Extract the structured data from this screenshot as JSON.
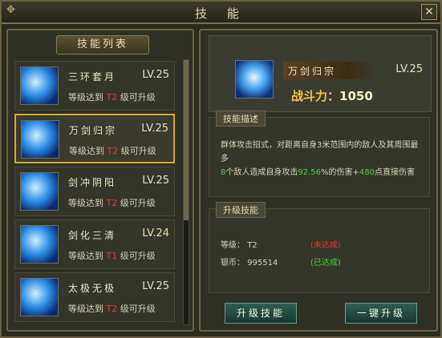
{
  "window": {
    "title": "技 能",
    "close_label": "✕"
  },
  "skill_list": {
    "header": "技能列表",
    "items": [
      {
        "name": "三环套月",
        "level": "LV.25",
        "req_prefix": "等级达到",
        "req_tier": "T2",
        "req_suffix": "级可升级"
      },
      {
        "name": "万剑归宗",
        "level": "LV.25",
        "req_prefix": "等级达到",
        "req_tier": "T2",
        "req_suffix": "级可升级"
      },
      {
        "name": "剑冲阴阳",
        "level": "LV.25",
        "req_prefix": "等级达到",
        "req_tier": "T2",
        "req_suffix": "级可升级"
      },
      {
        "name": "剑化三清",
        "level": "LV.24",
        "req_prefix": "等级达到",
        "req_tier": "T1",
        "req_suffix": "级可升级"
      },
      {
        "name": "太极无极",
        "level": "LV.25",
        "req_prefix": "等级达到",
        "req_tier": "T2",
        "req_suffix": "级可升级"
      }
    ],
    "selected_index": 1
  },
  "detail": {
    "name": "万剑归宗",
    "level": "LV.25",
    "power_label": "战斗力：",
    "power_value": "1050",
    "desc_title": "技能描述",
    "desc_line1": "群体攻击招式，对距离自身3米范围内的敌人及其周围最多",
    "desc_line2a": "8",
    "desc_line2b": "个敌人造成自身攻击",
    "desc_line2c": "92.56",
    "desc_line2d": "%的伤害+",
    "desc_line2e": "480",
    "desc_line2f": "点直接伤害",
    "upgrade_title": "升级技能",
    "level_label": "等级：",
    "level_value": "T2",
    "level_status": "(未达成)",
    "silver_label": "银币：",
    "silver_value": "995514",
    "silver_status": "(已达成)"
  },
  "buttons": {
    "upgrade": "升级技能",
    "one_click": "一键升级"
  }
}
